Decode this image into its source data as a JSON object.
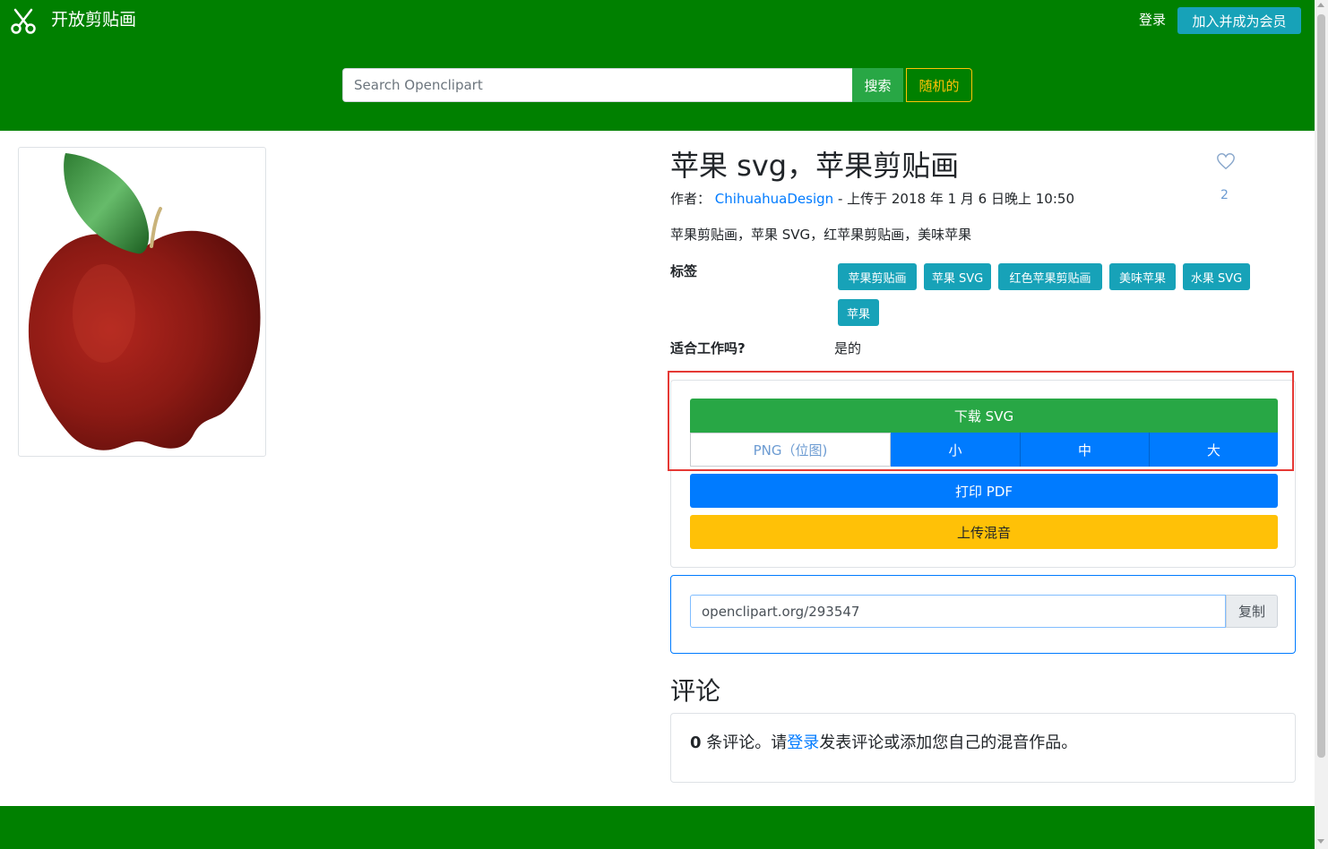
{
  "header": {
    "brand": "开放剪贴画",
    "login": "登录",
    "join": "加入并成为会员",
    "search_placeholder": "Search Openclipart",
    "search_button": "搜索",
    "random_button": "随机的"
  },
  "clipart": {
    "title": "苹果 svg，苹果剪贴画",
    "author_prefix": "作者：",
    "author": "ChihuahuaDesign",
    "uploaded": "- 上传于 2018 年 1 月 6 日晚上 10:50",
    "favorites": "2",
    "description": "苹果剪贴画，苹果 SVG，红苹果剪贴画，美味苹果",
    "tags_label": "标签",
    "tags": [
      "苹果剪贴画",
      "苹果 SVG",
      "红色苹果剪贴画",
      "美味苹果",
      "水果 SVG",
      "苹果"
    ],
    "sfw_label": "适合工作吗?",
    "sfw_value": "是的"
  },
  "download": {
    "svg": "下载 SVG",
    "png_label": "PNG（位图)",
    "sizes": [
      "小",
      "中",
      "大"
    ],
    "pdf": "打印 PDF",
    "remix": "上传混音"
  },
  "share": {
    "link": "openclipart.org/293547",
    "copy": "复制"
  },
  "comments": {
    "title": "评论",
    "count": "0",
    "text_before": " 条评论。请",
    "login_link": "登录",
    "text_after": "发表评论或添加您自己的混音作品。"
  },
  "icons": {
    "logo": "scissors-icon",
    "favorite": "heart-icon"
  },
  "colors": {
    "header_bg": "#008000",
    "info": "#17a2b8",
    "success": "#28a745",
    "primary": "#007bff",
    "warning": "#ffc107",
    "highlight": "#e53935"
  }
}
